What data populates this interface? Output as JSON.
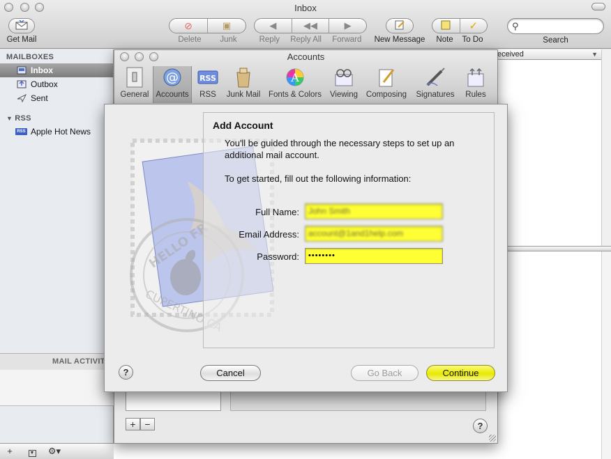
{
  "window": {
    "title": "Inbox"
  },
  "toolbar": {
    "get_mail": "Get Mail",
    "delete": "Delete",
    "junk": "Junk",
    "reply": "Reply",
    "reply_all": "Reply All",
    "forward": "Forward",
    "new_message": "New Message",
    "note": "Note",
    "todo": "To Do",
    "search_label": "Search",
    "search_value": ""
  },
  "sidebar": {
    "mailboxes_header": "MAILBOXES",
    "items": [
      {
        "label": "Inbox"
      },
      {
        "label": "Outbox"
      },
      {
        "label": "Sent"
      }
    ],
    "rss_header": "RSS",
    "rss_items": [
      {
        "label": "Apple Hot News"
      }
    ],
    "activity_header": "MAIL ACTIVITY"
  },
  "message_list": {
    "column_header": "eceived"
  },
  "prefs": {
    "title": "Accounts",
    "tabs": [
      {
        "label": "General"
      },
      {
        "label": "Accounts"
      },
      {
        "label": "RSS"
      },
      {
        "label": "Junk Mail"
      },
      {
        "label": "Fonts & Colors"
      },
      {
        "label": "Viewing"
      },
      {
        "label": "Composing"
      },
      {
        "label": "Signatures"
      },
      {
        "label": "Rules"
      }
    ],
    "active_tab": "Accounts"
  },
  "sheet": {
    "title": "Add Account",
    "intro": "You'll be guided through the necessary steps to set up an additional mail account.",
    "instruction": "To get started, fill out the following information:",
    "fields": {
      "full_name_label": "Full Name:",
      "full_name_value": "John Smith",
      "email_label": "Email Address:",
      "email_value": "account@1and1help.com",
      "password_label": "Password:",
      "password_value": "••••••••"
    },
    "buttons": {
      "help": "?",
      "cancel": "Cancel",
      "go_back": "Go Back",
      "continue": "Continue"
    }
  },
  "colors": {
    "field_highlight": "#ffff33",
    "default_button": "#e8e800",
    "selection": "#8c8c8c"
  }
}
